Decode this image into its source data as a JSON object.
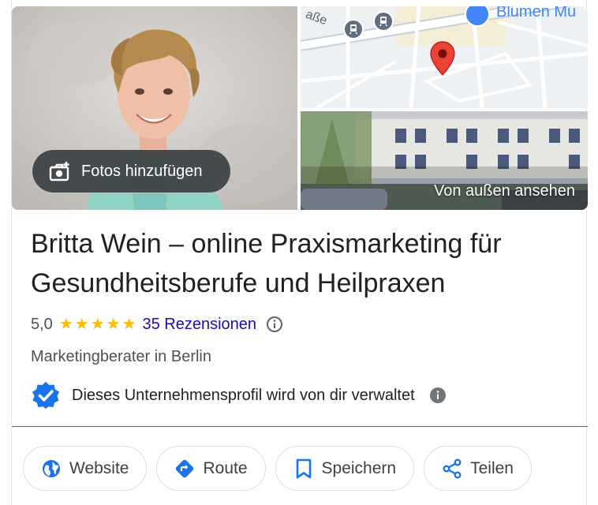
{
  "colors": {
    "accent_blue": "#1a73e8",
    "link_blue": "#1a0dab",
    "star_yellow": "#fbbc04",
    "map_pin_red": "#ea4335",
    "text_primary": "#202124",
    "text_secondary": "#4d5156"
  },
  "media": {
    "add_photos_label": "Fotos hinzufügen",
    "add_photos_icon": "camera-plus-icon",
    "map_partial_street": "aße",
    "map_partial_place": "Blumen Mu",
    "street_view_label": "Von außen ansehen"
  },
  "business": {
    "name": "Britta Wein – online Praxismarketing für Gesundheitsberufe und Heilpraxen",
    "rating": "5,0",
    "star_count": 5,
    "reviews_label": "35 Rezensionen",
    "category": "Marketingberater in Berlin",
    "verified_text": "Dieses Unternehmensprofil wird von dir verwaltet"
  },
  "actions": [
    {
      "label": "Website",
      "icon": "globe-icon"
    },
    {
      "label": "Route",
      "icon": "directions-icon"
    },
    {
      "label": "Speichern",
      "icon": "bookmark-icon"
    },
    {
      "label": "Teilen",
      "icon": "share-icon"
    }
  ]
}
